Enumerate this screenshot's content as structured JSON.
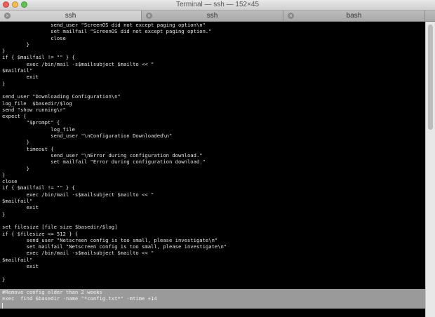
{
  "window": {
    "title": "Terminal — ssh — 152×45"
  },
  "colors": {
    "close": "#ee5f5b",
    "minimize": "#f5bf4f",
    "zoom": "#61c554",
    "selection": "#9a9a9a"
  },
  "tabs": [
    {
      "label": "ssh",
      "active": true
    },
    {
      "label": "ssh",
      "active": false
    },
    {
      "label": "bash",
      "active": false
    }
  ],
  "terminal": {
    "lines": [
      "                send_user \"ScreenOS did not except paging option\\n\"",
      "                set mailfail \"ScreenOS did not except paging option.\"",
      "                close",
      "        }",
      "}",
      "if { $mailfail != \"\" } {",
      "        exec /bin/mail -s$mailsubject $mailto << \"",
      "$mailfail\"",
      "        exit",
      "}",
      "",
      "send_user \"Downloading Configuration\\n\"",
      "log_file  $basedir/$log",
      "send \"show running\\r\"",
      "expect {",
      "        \"$prompt\" {",
      "                log_file",
      "                send_user \"\\nConfiguration Downloaded\\n\"",
      "        }",
      "        timeout {",
      "                send_user \"\\nError during configuration download.\"",
      "                set mailfail \"Error during configuration download.\"",
      "        }",
      "}",
      "close",
      "if { $mailfail != \"\" } {",
      "        exec /bin/mail -s$mailsubject $mailto << \"",
      "$mailfail\"",
      "        exit",
      "}",
      "",
      "set filesize [file size $basedir/$log]",
      "if { $filesize <= 512 } {",
      "        send_user \"Netscreen config is too small, please investigate\\n\"",
      "        set mailfail \"Netscreen config is too small, please investigate\\n\"",
      "        exec /bin/mail -s$mailsubject $mailto << \"",
      "$mailfail\"",
      "        exit",
      "",
      "}",
      "",
      "#Remove config older than 2 weeks",
      "exec  find $basedir -name \"*config.txt*\" -mtime +14",
      ""
    ],
    "selected_from": 41
  }
}
